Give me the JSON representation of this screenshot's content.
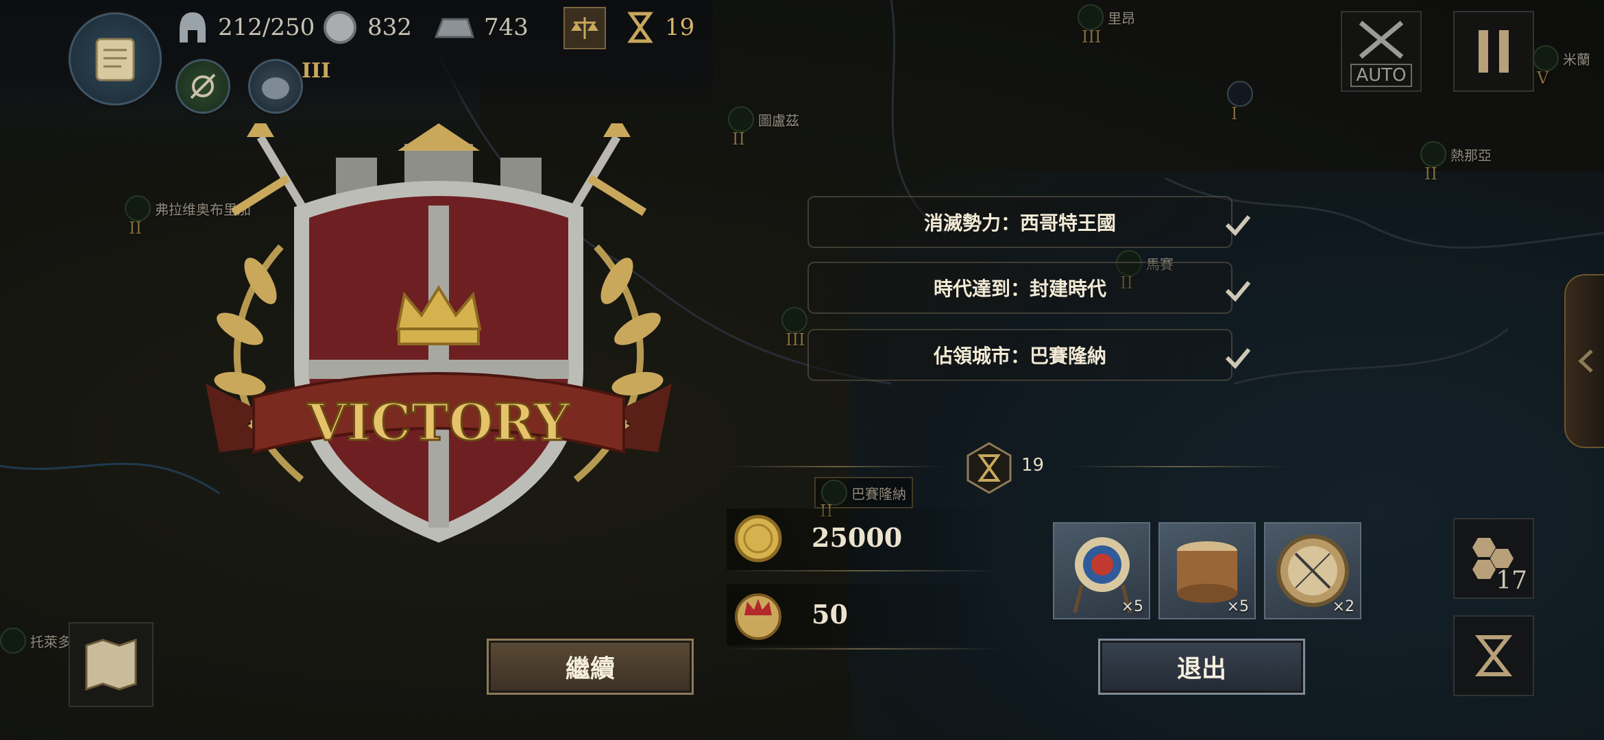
{
  "topbar": {
    "troops": "212/250",
    "silver": "832",
    "iron": "743",
    "turns": "19",
    "era_level": "III"
  },
  "controls": {
    "auto_label": "AUTO"
  },
  "map_cities": [
    {
      "name": "圖盧茲",
      "level": "II"
    },
    {
      "name": "弗拉维奥布里加",
      "level": "II"
    },
    {
      "name": "里昂",
      "level": "III"
    },
    {
      "name": "熱那亞",
      "level": "II"
    },
    {
      "name": "米蘭",
      "level": "V"
    },
    {
      "name": "馬賽",
      "level": "II"
    },
    {
      "name": "巴賽隆納",
      "level": "II"
    },
    {
      "name": "托萊多",
      "level": ""
    }
  ],
  "map_levels": {
    "center": "III",
    "north": "I"
  },
  "victory": {
    "banner": "VICTORY",
    "objectives": [
      {
        "text": "消滅勢力：西哥特王國",
        "done": true
      },
      {
        "text": "時代達到：封建時代",
        "done": true
      },
      {
        "text": "佔領城市：巴賽隆納",
        "done": true
      }
    ],
    "turn_count": "19",
    "gold": "25000",
    "honor": "50",
    "items": [
      {
        "name": "target-icon",
        "qty": "×5"
      },
      {
        "name": "drum-icon",
        "qty": "×5"
      },
      {
        "name": "compass-icon",
        "qty": "×2"
      }
    ],
    "continue_label": "繼續",
    "exit_label": "退出"
  },
  "side": {
    "hex_count": "17"
  },
  "colors": {
    "gold": "#c9a85c",
    "shield_red": "#6e1f22",
    "ribbon": "#7a2a1f",
    "continue_bg": "#4a3d2c",
    "exit_bg": "#2c3440"
  }
}
